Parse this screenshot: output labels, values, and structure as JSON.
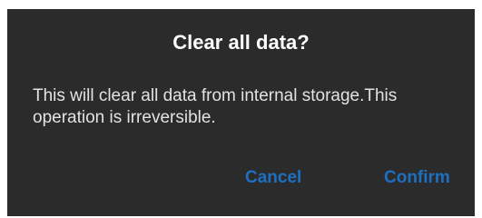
{
  "dialog": {
    "title": "Clear all data?",
    "message": "This will clear all data from internal storage.This operation is irreversible.",
    "cancel_label": "Cancel",
    "confirm_label": "Confirm"
  },
  "colors": {
    "dialog_background": "#2b2b2b",
    "title_text": "#ffffff",
    "message_text": "#e2e2e2",
    "button_text": "#1e6fc2"
  }
}
